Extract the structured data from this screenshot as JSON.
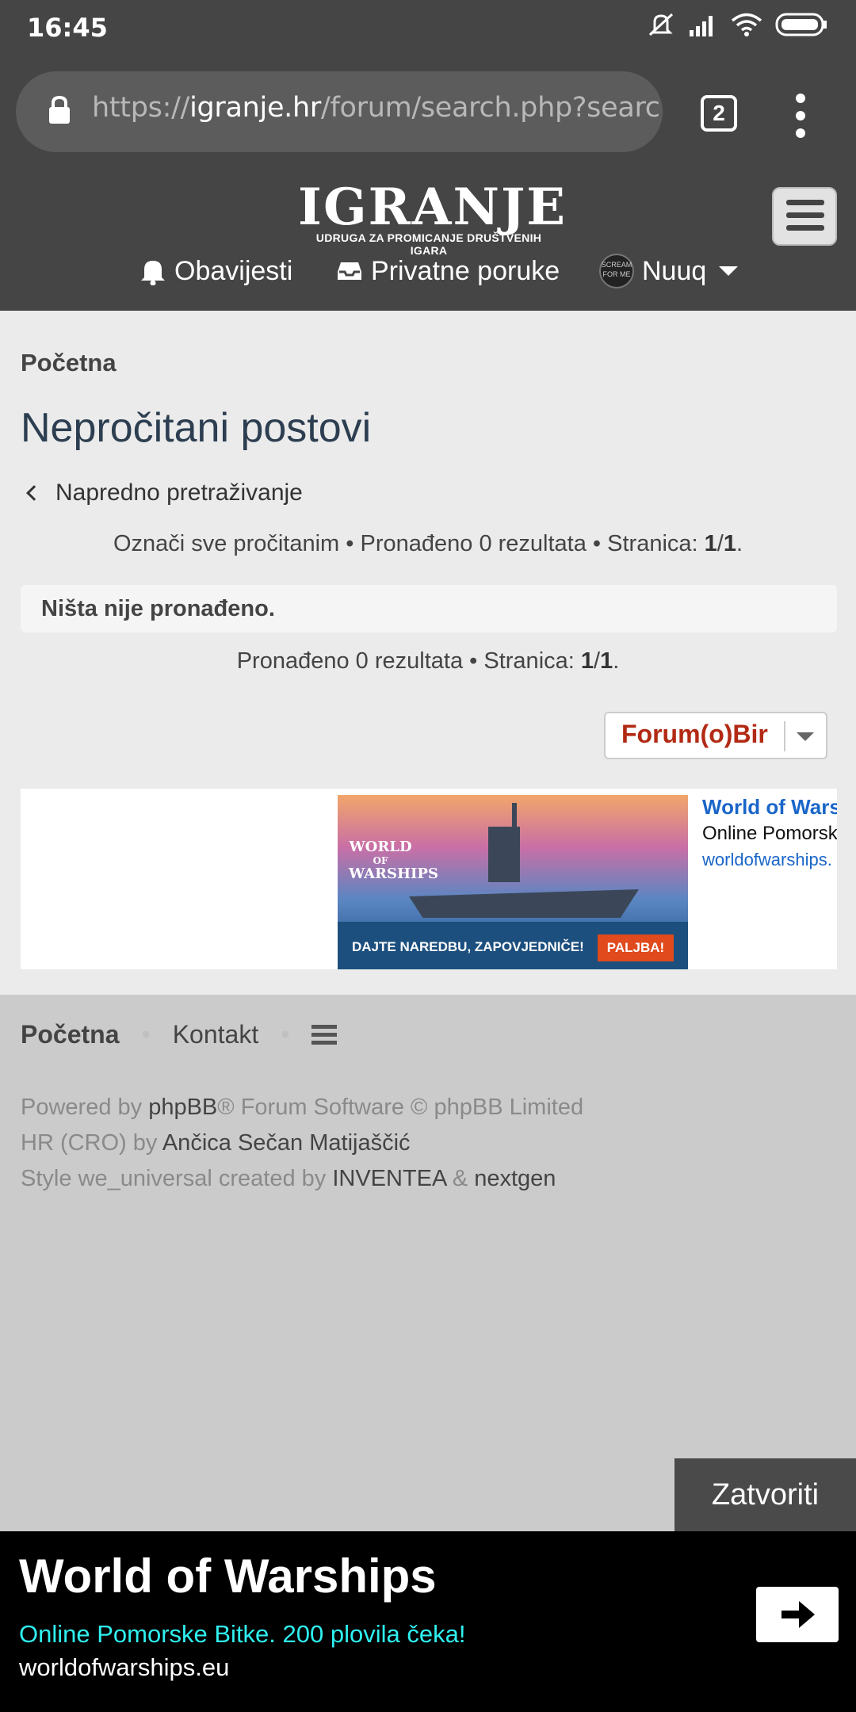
{
  "status_bar": {
    "time": "16:45"
  },
  "browser": {
    "url_prefix": "https://",
    "url_host": "igranje.hr",
    "url_path": "/forum/search.php?search_i",
    "tab_count": "2"
  },
  "site_header": {
    "logo_text": "IGRANJE",
    "logo_subtitle": "UDRUGA ZA PROMICANJE DRUŠTVENIH IGARA",
    "notifications_label": "Obavijesti",
    "private_messages_label": "Privatne poruke",
    "user_name": "Nuuq",
    "avatar_text": "SCREAM FOR ME"
  },
  "breadcrumb": {
    "home": "Početna"
  },
  "page": {
    "title": "Nepročitani postovi",
    "advanced_search": "Napredno pretraživanje",
    "info_top": {
      "mark_read": "Označi sve pročitanim",
      "sep1": " • ",
      "found": "Pronađeno 0 rezultata",
      "sep2": " • ",
      "page_label": "Stranica: ",
      "page_current": "1",
      "page_sep": "/",
      "page_total": "1",
      "end": "."
    },
    "nothing_found": "Ništa nije pronađeno.",
    "info_bottom": {
      "found": "Pronađeno 0 rezultata",
      "sep": " • ",
      "page_label": "Stranica: ",
      "page_current": "1",
      "page_sep": "/",
      "page_total": "1",
      "end": "."
    },
    "jumpbox_label": "Forum(o)Bir"
  },
  "inline_ad": {
    "logo_line1": "WORLD",
    "logo_line2": "OF",
    "logo_line3": "WARSHIPS",
    "slogan": "DAJTE NAREDBU, ZAPOVJEDNIČE!",
    "button": "PALJBA!",
    "title": "World of Warsl",
    "desc": "Online Pomorsk",
    "url": "worldofwarships."
  },
  "footer": {
    "home": "Početna",
    "contact": "Kontakt",
    "separator": "•",
    "credits": {
      "line1_a": "Powered by ",
      "line1_link": "phpBB",
      "line1_b": "® Forum Software © phpBB Limited",
      "line2_a": "HR (CRO) by ",
      "line2_link": "Ančica Sečan Matijaščić",
      "line3_a": "Style we_universal created by ",
      "line3_link1": "INVENTEA",
      "line3_amp": " & ",
      "line3_link2": "nextgen"
    }
  },
  "close_button": "Zatvoriti",
  "bottom_ad": {
    "title": "World of Warships",
    "desc": "Online Pomorske Bitke. 200 plovila čeka!",
    "url": "worldofwarships.eu"
  }
}
